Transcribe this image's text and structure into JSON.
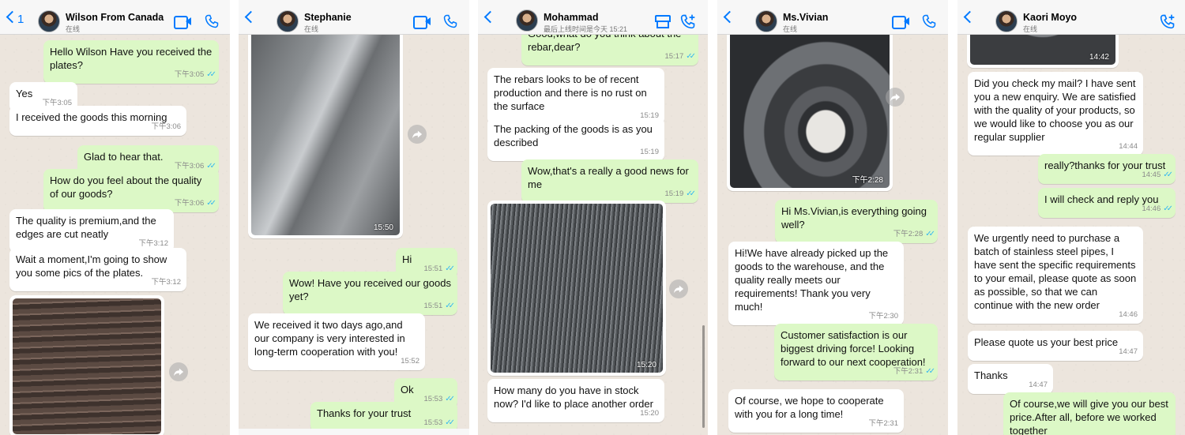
{
  "chats": [
    {
      "contact": "Wilson From Canada",
      "status": "在线",
      "back_count": "1",
      "messages": [
        {
          "text": "Hello Wilson Have you received the plates?",
          "time": "下午3:05",
          "ticks": "✓✓"
        },
        {
          "text": "Yes",
          "time": "下午3:05"
        },
        {
          "text": "I received the goods this morning",
          "time": "下午3:06"
        },
        {
          "text": "Glad to hear that.",
          "time": "下午3:06",
          "ticks": "✓✓"
        },
        {
          "text": "How do you feel about the quality of our goods?",
          "time": "下午3:06",
          "ticks": "✓✓"
        },
        {
          "text": "The quality is premium,and the edges are cut neatly",
          "time": "下午3:12"
        },
        {
          "text": "Wait a moment,I'm going to show you some pics of the plates.",
          "time": "下午3:12"
        }
      ]
    },
    {
      "contact": "Stephanie",
      "status": "在线",
      "photo_time": "15:50",
      "messages": [
        {
          "text": "Hi",
          "time": "15:51",
          "ticks": "✓✓"
        },
        {
          "text": "Wow! Have you received our goods yet?",
          "time": "15:51",
          "ticks": "✓✓"
        },
        {
          "text": "We received it two days ago,and our company is very interested in long-term cooperation with you!",
          "time": "15:52"
        },
        {
          "text": "Ok",
          "time": "15:53",
          "ticks": "✓✓"
        },
        {
          "text": "Thanks for your trust",
          "time": "15:53",
          "ticks": "✓✓"
        }
      ]
    },
    {
      "contact": "Mohammad",
      "status": "最后上线时间是今天 15:21",
      "photo_time": "15:20",
      "messages": [
        {
          "text": "Good,what do you think about the rebar,dear?",
          "time": "15:17",
          "ticks": "✓✓"
        },
        {
          "text": "The rebars looks to be of recent production and there is no rust on the surface",
          "time": "15:19"
        },
        {
          "text": "The packing of the goods is as you described",
          "time": "15:19"
        },
        {
          "text": "Wow,that's a really a good news for me",
          "time": "15:19",
          "ticks": "✓✓"
        },
        {
          "text": "How many do you have in stock now? I'd like to place another order",
          "time": "15:20"
        }
      ]
    },
    {
      "contact": "Ms.Vivian",
      "status": "在线",
      "photo_time": "下午2:28",
      "messages": [
        {
          "text": "Hi Ms.Vivian,is everything going well?",
          "time": "下午2:28",
          "ticks": "✓✓"
        },
        {
          "text": "Hi!We have already picked up the goods to the warehouse, and the quality really meets our requirements! Thank you very much!",
          "time": "下午2:30"
        },
        {
          "text": "Customer satisfaction is our biggest driving force! Looking forward to our next cooperation!",
          "time": "下午2:31",
          "ticks": "✓✓"
        },
        {
          "text": "Of course, we hope to cooperate with you for a long time!",
          "time": "下午2:31"
        }
      ]
    },
    {
      "contact": "Kaori Moyo",
      "status": "在线",
      "photo_time": "14:42",
      "messages": [
        {
          "text": "Did you check my mail? I have sent you a new enquiry. We are satisfied with the quality of your products, so we would like to choose you as our regular supplier",
          "time": "14:44"
        },
        {
          "text": "really?thanks for your trust",
          "time": "14:45",
          "ticks": "✓✓"
        },
        {
          "text": "I will check and reply you",
          "time": "14:46",
          "ticks": "✓✓"
        },
        {
          "text": "We urgently need to purchase a batch of stainless steel pipes, I have sent the specific requirements to your email, please quote as soon as possible, so that we can continue with the new order",
          "time": "14:46"
        },
        {
          "text": "Please quote us your best price",
          "time": "14:47"
        },
        {
          "text": "Thanks",
          "time": "14:47"
        },
        {
          "text": "Of course,we will give you our best price.After all, before we worked together",
          "time": ""
        }
      ]
    }
  ],
  "colors": {
    "incoming": "#ffffff",
    "outgoing": "#dcf8c6",
    "accent": "#007aff",
    "read_ticks": "#34b7f1",
    "wallpaper": "#ece5dd"
  },
  "icons": [
    "back-chevron-icon",
    "video-call-icon",
    "phone-icon",
    "store-icon",
    "add-call-icon",
    "forward-icon"
  ]
}
